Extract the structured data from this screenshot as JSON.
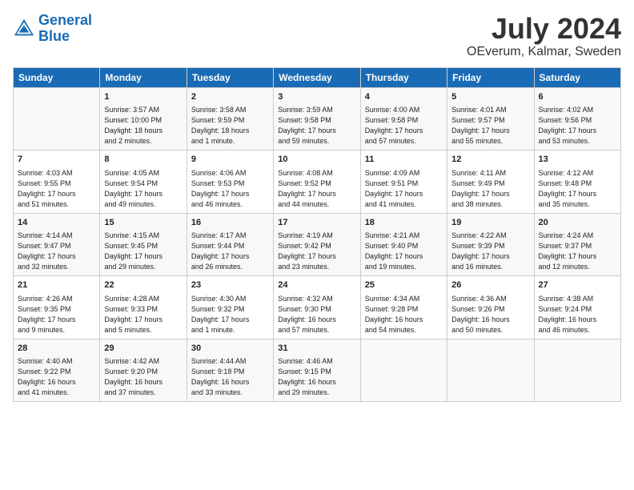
{
  "header": {
    "logo_line1": "General",
    "logo_line2": "Blue",
    "main_title": "July 2024",
    "subtitle": "OEverum, Kalmar, Sweden"
  },
  "columns": [
    "Sunday",
    "Monday",
    "Tuesday",
    "Wednesday",
    "Thursday",
    "Friday",
    "Saturday"
  ],
  "rows": [
    [
      {
        "day": "",
        "lines": []
      },
      {
        "day": "1",
        "lines": [
          "Sunrise: 3:57 AM",
          "Sunset: 10:00 PM",
          "Daylight: 18 hours",
          "and 2 minutes."
        ]
      },
      {
        "day": "2",
        "lines": [
          "Sunrise: 3:58 AM",
          "Sunset: 9:59 PM",
          "Daylight: 18 hours",
          "and 1 minute."
        ]
      },
      {
        "day": "3",
        "lines": [
          "Sunrise: 3:59 AM",
          "Sunset: 9:58 PM",
          "Daylight: 17 hours",
          "and 59 minutes."
        ]
      },
      {
        "day": "4",
        "lines": [
          "Sunrise: 4:00 AM",
          "Sunset: 9:58 PM",
          "Daylight: 17 hours",
          "and 57 minutes."
        ]
      },
      {
        "day": "5",
        "lines": [
          "Sunrise: 4:01 AM",
          "Sunset: 9:57 PM",
          "Daylight: 17 hours",
          "and 55 minutes."
        ]
      },
      {
        "day": "6",
        "lines": [
          "Sunrise: 4:02 AM",
          "Sunset: 9:56 PM",
          "Daylight: 17 hours",
          "and 53 minutes."
        ]
      }
    ],
    [
      {
        "day": "7",
        "lines": [
          "Sunrise: 4:03 AM",
          "Sunset: 9:55 PM",
          "Daylight: 17 hours",
          "and 51 minutes."
        ]
      },
      {
        "day": "8",
        "lines": [
          "Sunrise: 4:05 AM",
          "Sunset: 9:54 PM",
          "Daylight: 17 hours",
          "and 49 minutes."
        ]
      },
      {
        "day": "9",
        "lines": [
          "Sunrise: 4:06 AM",
          "Sunset: 9:53 PM",
          "Daylight: 17 hours",
          "and 46 minutes."
        ]
      },
      {
        "day": "10",
        "lines": [
          "Sunrise: 4:08 AM",
          "Sunset: 9:52 PM",
          "Daylight: 17 hours",
          "and 44 minutes."
        ]
      },
      {
        "day": "11",
        "lines": [
          "Sunrise: 4:09 AM",
          "Sunset: 9:51 PM",
          "Daylight: 17 hours",
          "and 41 minutes."
        ]
      },
      {
        "day": "12",
        "lines": [
          "Sunrise: 4:11 AM",
          "Sunset: 9:49 PM",
          "Daylight: 17 hours",
          "and 38 minutes."
        ]
      },
      {
        "day": "13",
        "lines": [
          "Sunrise: 4:12 AM",
          "Sunset: 9:48 PM",
          "Daylight: 17 hours",
          "and 35 minutes."
        ]
      }
    ],
    [
      {
        "day": "14",
        "lines": [
          "Sunrise: 4:14 AM",
          "Sunset: 9:47 PM",
          "Daylight: 17 hours",
          "and 32 minutes."
        ]
      },
      {
        "day": "15",
        "lines": [
          "Sunrise: 4:15 AM",
          "Sunset: 9:45 PM",
          "Daylight: 17 hours",
          "and 29 minutes."
        ]
      },
      {
        "day": "16",
        "lines": [
          "Sunrise: 4:17 AM",
          "Sunset: 9:44 PM",
          "Daylight: 17 hours",
          "and 26 minutes."
        ]
      },
      {
        "day": "17",
        "lines": [
          "Sunrise: 4:19 AM",
          "Sunset: 9:42 PM",
          "Daylight: 17 hours",
          "and 23 minutes."
        ]
      },
      {
        "day": "18",
        "lines": [
          "Sunrise: 4:21 AM",
          "Sunset: 9:40 PM",
          "Daylight: 17 hours",
          "and 19 minutes."
        ]
      },
      {
        "day": "19",
        "lines": [
          "Sunrise: 4:22 AM",
          "Sunset: 9:39 PM",
          "Daylight: 17 hours",
          "and 16 minutes."
        ]
      },
      {
        "day": "20",
        "lines": [
          "Sunrise: 4:24 AM",
          "Sunset: 9:37 PM",
          "Daylight: 17 hours",
          "and 12 minutes."
        ]
      }
    ],
    [
      {
        "day": "21",
        "lines": [
          "Sunrise: 4:26 AM",
          "Sunset: 9:35 PM",
          "Daylight: 17 hours",
          "and 9 minutes."
        ]
      },
      {
        "day": "22",
        "lines": [
          "Sunrise: 4:28 AM",
          "Sunset: 9:33 PM",
          "Daylight: 17 hours",
          "and 5 minutes."
        ]
      },
      {
        "day": "23",
        "lines": [
          "Sunrise: 4:30 AM",
          "Sunset: 9:32 PM",
          "Daylight: 17 hours",
          "and 1 minute."
        ]
      },
      {
        "day": "24",
        "lines": [
          "Sunrise: 4:32 AM",
          "Sunset: 9:30 PM",
          "Daylight: 16 hours",
          "and 57 minutes."
        ]
      },
      {
        "day": "25",
        "lines": [
          "Sunrise: 4:34 AM",
          "Sunset: 9:28 PM",
          "Daylight: 16 hours",
          "and 54 minutes."
        ]
      },
      {
        "day": "26",
        "lines": [
          "Sunrise: 4:36 AM",
          "Sunset: 9:26 PM",
          "Daylight: 16 hours",
          "and 50 minutes."
        ]
      },
      {
        "day": "27",
        "lines": [
          "Sunrise: 4:38 AM",
          "Sunset: 9:24 PM",
          "Daylight: 16 hours",
          "and 46 minutes."
        ]
      }
    ],
    [
      {
        "day": "28",
        "lines": [
          "Sunrise: 4:40 AM",
          "Sunset: 9:22 PM",
          "Daylight: 16 hours",
          "and 41 minutes."
        ]
      },
      {
        "day": "29",
        "lines": [
          "Sunrise: 4:42 AM",
          "Sunset: 9:20 PM",
          "Daylight: 16 hours",
          "and 37 minutes."
        ]
      },
      {
        "day": "30",
        "lines": [
          "Sunrise: 4:44 AM",
          "Sunset: 9:18 PM",
          "Daylight: 16 hours",
          "and 33 minutes."
        ]
      },
      {
        "day": "31",
        "lines": [
          "Sunrise: 4:46 AM",
          "Sunset: 9:15 PM",
          "Daylight: 16 hours",
          "and 29 minutes."
        ]
      },
      {
        "day": "",
        "lines": []
      },
      {
        "day": "",
        "lines": []
      },
      {
        "day": "",
        "lines": []
      }
    ]
  ]
}
